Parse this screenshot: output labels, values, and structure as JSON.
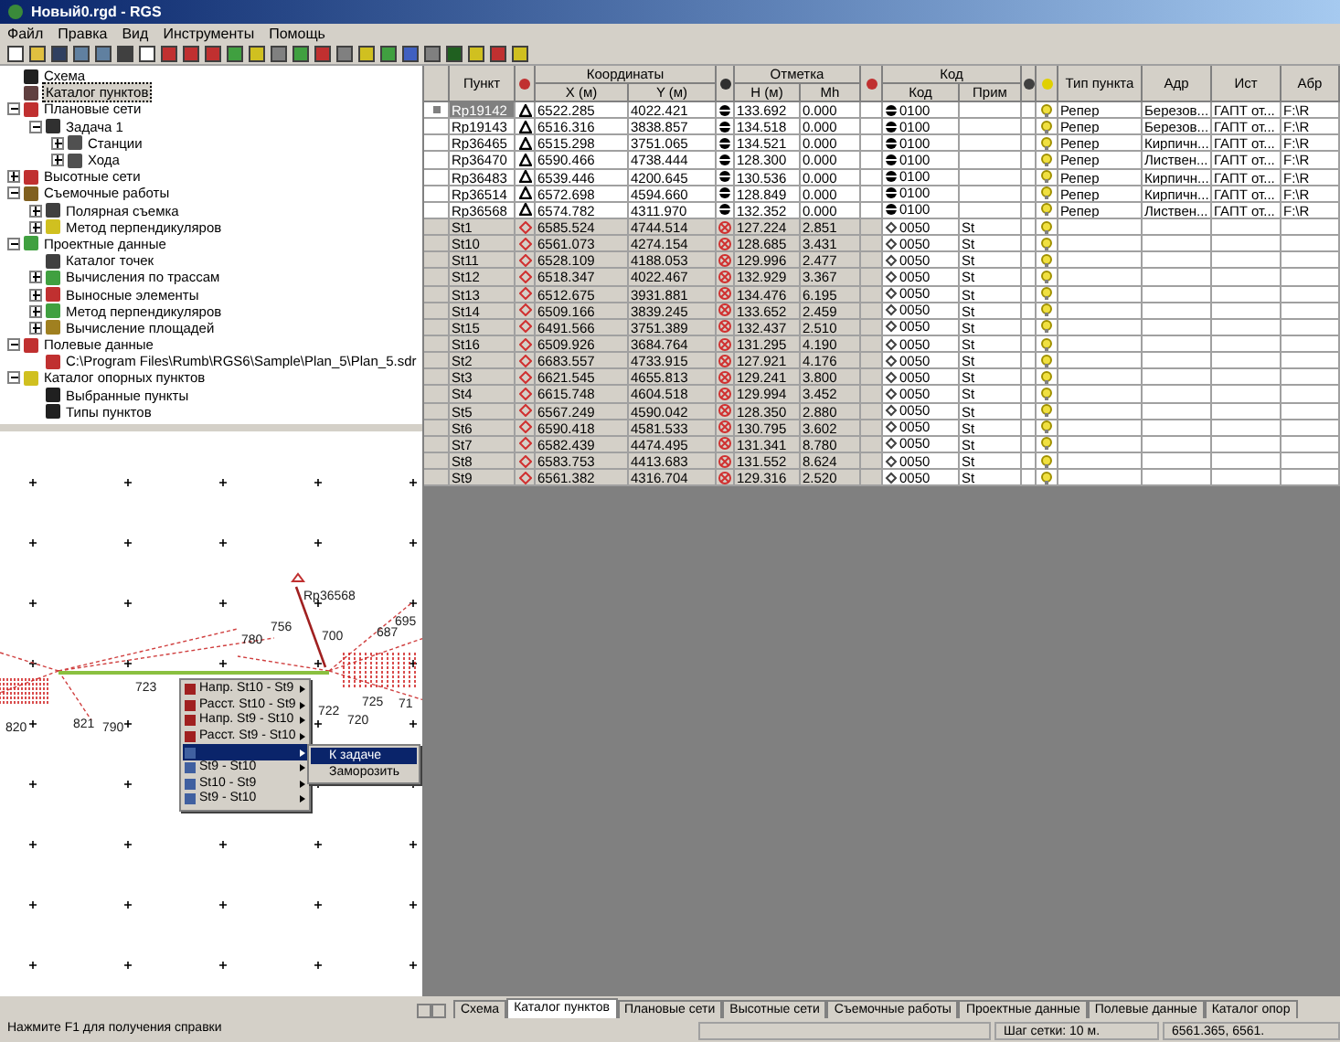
{
  "window": {
    "title": "Новый0.rgd - RGS"
  },
  "menu": [
    "Файл",
    "Правка",
    "Вид",
    "Инструменты",
    "Помощь"
  ],
  "tree": [
    {
      "label": "Схема",
      "color": "#202020",
      "selected": false
    },
    {
      "label": "Каталог пунктов",
      "color": "#604040",
      "selected": true
    },
    {
      "label": "Плановые сети",
      "color": "#c03030",
      "selected": false,
      "expanded": true,
      "children": [
        {
          "label": "Задача 1",
          "color": "#303030",
          "selected": false,
          "expanded": true,
          "children": [
            {
              "label": "Станции",
              "color": "#505050",
              "selected": false,
              "expanded": false
            },
            {
              "label": "Хода",
              "color": "#505050",
              "selected": false,
              "expanded": false
            }
          ]
        }
      ]
    },
    {
      "label": "Высотные сети",
      "color": "#c03030",
      "selected": false,
      "expanded": false
    },
    {
      "label": "Съемочные работы",
      "color": "#806020",
      "selected": false,
      "expanded": true,
      "children": [
        {
          "label": "Полярная съемка",
          "color": "#404040",
          "selected": false,
          "expanded": false
        },
        {
          "label": "Метод перпендикуляров",
          "color": "#d0c020",
          "selected": false,
          "expanded": false
        }
      ]
    },
    {
      "label": "Проектные данные",
      "color": "#40a040",
      "selected": false,
      "expanded": true,
      "children": [
        {
          "label": "Каталог точек",
          "color": "#404040",
          "selected": false
        },
        {
          "label": "Вычисления по трассам",
          "color": "#40a040",
          "selected": false,
          "expanded": false
        },
        {
          "label": "Выносные элементы",
          "color": "#c03030",
          "selected": false,
          "expanded": false
        },
        {
          "label": "Метод перпендикуляров",
          "color": "#40a040",
          "selected": false,
          "expanded": false
        },
        {
          "label": "Вычисление площадей",
          "color": "#a08020",
          "selected": false,
          "expanded": false
        }
      ]
    },
    {
      "label": "Полевые данные",
      "color": "#c03030",
      "selected": false,
      "expanded": true,
      "children": [
        {
          "label": "C:\\Program Files\\Rumb\\RGS6\\Sample\\Plan_5\\Plan_5.sdr",
          "color": "#c03030",
          "selected": false
        }
      ]
    },
    {
      "label": "Каталог опорных пунктов",
      "color": "#d0c020",
      "selected": false,
      "expanded": true,
      "children": [
        {
          "label": "Выбранные пункты",
          "color": "#202020",
          "selected": false
        },
        {
          "label": "Типы пунктов",
          "color": "#202020",
          "selected": false
        }
      ]
    }
  ],
  "table": {
    "groups": [
      "Координаты",
      "Отметка",
      "Код"
    ],
    "columns": [
      "Пункт",
      "X (м)",
      "Y (м)",
      "H (м)",
      "Mh",
      "Код",
      "Прим",
      "Тип пункта",
      "Адр",
      "Ист",
      "Абр"
    ],
    "rows": [
      {
        "kind": "rp",
        "selected": true,
        "cells": [
          "Rp19142",
          "6522.285",
          "4022.421",
          "133.692",
          "0.000",
          "0100",
          "",
          "Репер",
          "Березов...",
          "ГАПТ от...",
          "F:\\R"
        ]
      },
      {
        "kind": "rp",
        "selected": false,
        "cells": [
          "Rp19143",
          "6516.316",
          "3838.857",
          "134.518",
          "0.000",
          "0100",
          "",
          "Репер",
          "Березов...",
          "ГАПТ от...",
          "F:\\R"
        ]
      },
      {
        "kind": "rp",
        "selected": false,
        "cells": [
          "Rp36465",
          "6515.298",
          "3751.065",
          "134.521",
          "0.000",
          "0100",
          "",
          "Репер",
          "Кирпичн...",
          "ГАПТ от...",
          "F:\\R"
        ]
      },
      {
        "kind": "rp",
        "selected": false,
        "cells": [
          "Rp36470",
          "6590.466",
          "4738.444",
          "128.300",
          "0.000",
          "0100",
          "",
          "Репер",
          "Листвен...",
          "ГАПТ от...",
          "F:\\R"
        ]
      },
      {
        "kind": "rp",
        "selected": false,
        "cells": [
          "Rp36483",
          "6539.446",
          "4200.645",
          "130.536",
          "0.000",
          "0100",
          "",
          "Репер",
          "Кирпичн...",
          "ГАПТ от...",
          "F:\\R"
        ]
      },
      {
        "kind": "rp",
        "selected": false,
        "cells": [
          "Rp36514",
          "6572.698",
          "4594.660",
          "128.849",
          "0.000",
          "0100",
          "",
          "Репер",
          "Кирпичн...",
          "ГАПТ от...",
          "F:\\R"
        ]
      },
      {
        "kind": "rp",
        "selected": false,
        "cells": [
          "Rp36568",
          "6574.782",
          "4311.970",
          "132.352",
          "0.000",
          "0100",
          "",
          "Репер",
          "Листвен...",
          "ГАПТ от...",
          "F:\\R"
        ]
      },
      {
        "kind": "st",
        "selected": false,
        "cells": [
          "St1",
          "6585.524",
          "4744.514",
          "127.224",
          "2.851",
          "0050",
          "St"
        ]
      },
      {
        "kind": "st",
        "selected": false,
        "cells": [
          "St10",
          "6561.073",
          "4274.154",
          "128.685",
          "3.431",
          "0050",
          "St"
        ]
      },
      {
        "kind": "st",
        "selected": false,
        "cells": [
          "St11",
          "6528.109",
          "4188.053",
          "129.996",
          "2.477",
          "0050",
          "St"
        ]
      },
      {
        "kind": "st",
        "selected": false,
        "cells": [
          "St12",
          "6518.347",
          "4022.467",
          "132.929",
          "3.367",
          "0050",
          "St"
        ]
      },
      {
        "kind": "st",
        "selected": false,
        "cells": [
          "St13",
          "6512.675",
          "3931.881",
          "134.476",
          "6.195",
          "0050",
          "St"
        ]
      },
      {
        "kind": "st",
        "selected": false,
        "cells": [
          "St14",
          "6509.166",
          "3839.245",
          "133.652",
          "2.459",
          "0050",
          "St"
        ]
      },
      {
        "kind": "st",
        "selected": false,
        "cells": [
          "St15",
          "6491.566",
          "3751.389",
          "132.437",
          "2.510",
          "0050",
          "St"
        ]
      },
      {
        "kind": "st",
        "selected": false,
        "cells": [
          "St16",
          "6509.926",
          "3684.764",
          "131.295",
          "4.190",
          "0050",
          "St"
        ]
      },
      {
        "kind": "st",
        "selected": false,
        "cells": [
          "St2",
          "6683.557",
          "4733.915",
          "127.921",
          "4.176",
          "0050",
          "St"
        ]
      },
      {
        "kind": "st",
        "selected": false,
        "cells": [
          "St3",
          "6621.545",
          "4655.813",
          "129.241",
          "3.800",
          "0050",
          "St"
        ]
      },
      {
        "kind": "st",
        "selected": false,
        "cells": [
          "St4",
          "6615.748",
          "4604.518",
          "129.994",
          "3.452",
          "0050",
          "St"
        ]
      },
      {
        "kind": "st",
        "selected": false,
        "cells": [
          "St5",
          "6567.249",
          "4590.042",
          "128.350",
          "2.880",
          "0050",
          "St"
        ]
      },
      {
        "kind": "st",
        "selected": false,
        "cells": [
          "St6",
          "6590.418",
          "4581.533",
          "130.795",
          "3.602",
          "0050",
          "St"
        ]
      },
      {
        "kind": "st",
        "selected": false,
        "cells": [
          "St7",
          "6582.439",
          "4474.495",
          "131.341",
          "8.780",
          "0050",
          "St"
        ]
      },
      {
        "kind": "st",
        "selected": false,
        "cells": [
          "St8",
          "6583.753",
          "4413.683",
          "131.552",
          "8.624",
          "0050",
          "St"
        ]
      },
      {
        "kind": "st",
        "selected": false,
        "cells": [
          "St9",
          "6561.382",
          "4316.704",
          "129.316",
          "2.520",
          "0050",
          "St"
        ]
      }
    ]
  },
  "map": {
    "labels": [
      "Rp36568",
      "780",
      "756",
      "700",
      "687",
      "695",
      "820",
      "821",
      "790",
      "723",
      "722",
      "720",
      "725",
      "71"
    ],
    "menu": [
      {
        "label": "Напр. St10 - St9",
        "selected": false
      },
      {
        "label": "Расст. St10 - St9",
        "selected": false
      },
      {
        "label": "Напр. St9 - St10",
        "selected": false
      },
      {
        "label": "Расст. St9 - St10",
        "selected": false
      },
      {
        "selected": true
      },
      {
        "label": "St9 - St10",
        "selected": false
      },
      {
        "label": "St10 - St9",
        "selected": false
      },
      {
        "label": "St9 - St10",
        "selected": false
      }
    ],
    "submenu": [
      {
        "label": "К задаче",
        "selected": true
      },
      {
        "label": "Заморозить",
        "selected": false
      }
    ]
  },
  "tabs": [
    {
      "label": "Схема",
      "selected": false
    },
    {
      "label": "Каталог пунктов",
      "selected": true
    },
    {
      "label": "Плановые сети",
      "selected": false
    },
    {
      "label": "Высотные сети",
      "selected": false
    },
    {
      "label": "Съемочные работы",
      "selected": false
    },
    {
      "label": "Проектные данные",
      "selected": false
    },
    {
      "label": "Полевые данные",
      "selected": false
    },
    {
      "label": "Каталог опор",
      "selected": false
    }
  ],
  "status_bar": {
    "hint": "Нажмите F1 для получения справки",
    "grid": "Шаг сетки: 10 м.",
    "coords": "6561.365, 6561."
  }
}
